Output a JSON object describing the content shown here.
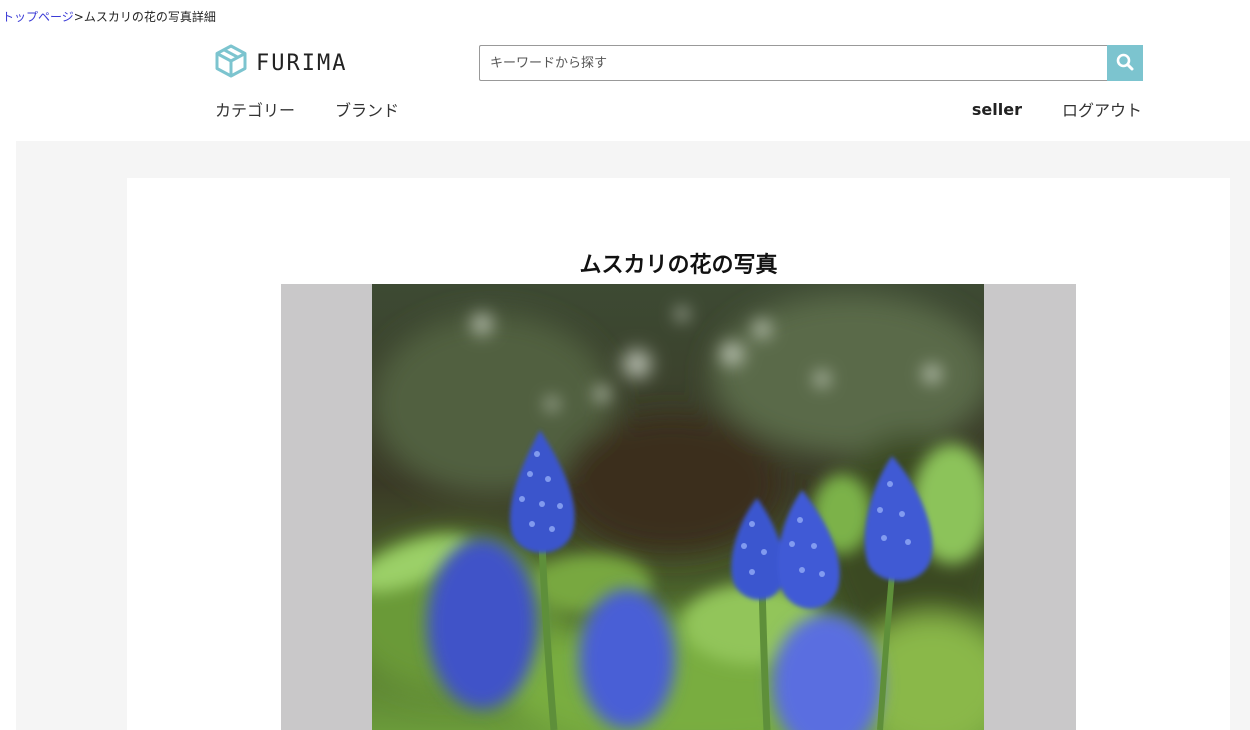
{
  "breadcrumb": {
    "home": "トップページ",
    "separator": ">",
    "current": "ムスカリの花の写真詳細"
  },
  "header": {
    "logo_text": "FURIMA",
    "search": {
      "placeholder": "キーワードから探す",
      "value": "",
      "button_icon": "search-icon"
    },
    "nav_left": [
      "カテゴリー",
      "ブランド"
    ],
    "user_name": "seller",
    "logout": "ログアウト"
  },
  "item": {
    "title": "ムスカリの花の写真"
  },
  "colors": {
    "accent": "#7cc4cf",
    "link": "#3b3bd6",
    "page_bg": "#f5f5f5",
    "image_frame": "#c9c8c9"
  }
}
